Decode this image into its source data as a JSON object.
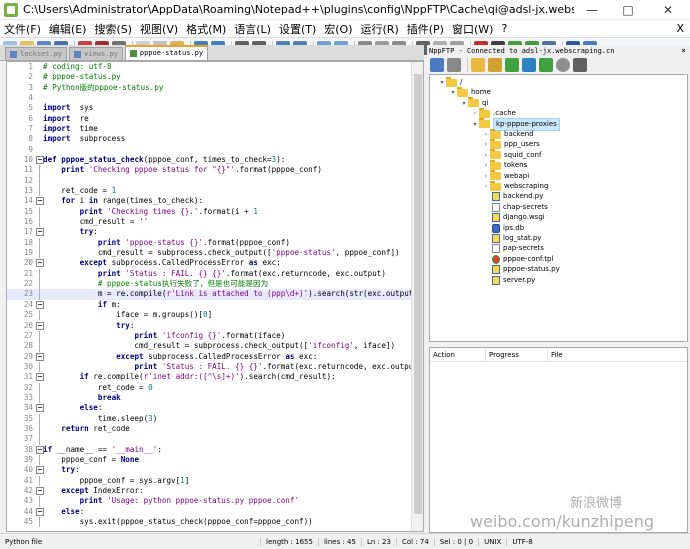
{
  "window": {
    "title": "C:\\Users\\Administrator\\AppData\\Roaming\\Notepad++\\plugins\\config\\NppFTP\\Cache\\qi@adsl-jx.webscraping.cn\\home\\qi\\kp-pppoe-proxies\\pppoe-status.py - Notepad++ [..."
  },
  "menu": {
    "items": [
      "文件(F)",
      "编辑(E)",
      "搜索(S)",
      "视图(V)",
      "格式(M)",
      "语言(L)",
      "设置(T)",
      "宏(O)",
      "运行(R)",
      "插件(P)",
      "窗口(W)",
      "?"
    ],
    "close_x": "X"
  },
  "tabs": [
    {
      "label": "lockset.py",
      "active": false
    },
    {
      "label": "views.py",
      "active": false
    },
    {
      "label": "pppoe-status.py",
      "active": true
    }
  ],
  "editor": {
    "lines": [
      [
        [
          "cm",
          "# coding: utf-8"
        ]
      ],
      [
        [
          "cm",
          "# pppoe-status.py"
        ]
      ],
      [
        [
          "cm",
          "# Python版的pppoe-status.py"
        ]
      ],
      [],
      [
        [
          "kw",
          "import"
        ],
        [
          "",
          "  sys"
        ]
      ],
      [
        [
          "kw",
          "import"
        ],
        [
          "",
          "  re"
        ]
      ],
      [
        [
          "kw",
          "import"
        ],
        [
          "",
          "  time"
        ]
      ],
      [
        [
          "kw",
          "import"
        ],
        [
          "",
          "  subprocess"
        ]
      ],
      [],
      [
        [
          "kw",
          "def"
        ],
        [
          "",
          " "
        ],
        [
          "fn",
          "pppoe_status_check"
        ],
        [
          "",
          "(pppoe_conf, times_to_check="
        ],
        [
          "nm",
          "3"
        ],
        [
          "",
          "):"
        ]
      ],
      [
        [
          "",
          "    "
        ],
        [
          "kw",
          "print"
        ],
        [
          "",
          ""
        ],
        [
          "st",
          " 'Checking pppoe status for \"{}\"'"
        ],
        [
          "",
          ".format(pppoe_conf)"
        ]
      ],
      [],
      [
        [
          "",
          "    ret_code = "
        ],
        [
          "nm",
          "1"
        ]
      ],
      [
        [
          "",
          "    "
        ],
        [
          "kw",
          "for"
        ],
        [
          "",
          " i "
        ],
        [
          "kw",
          "in"
        ],
        [
          "",
          " range(times_to_check):"
        ]
      ],
      [
        [
          "",
          "        "
        ],
        [
          "kw",
          "print"
        ],
        [
          "st",
          " 'Checking times {}.'"
        ],
        [
          "",
          ".format(i + "
        ],
        [
          "nm",
          "1"
        ],
        [
          ")"
        ]
      ],
      [
        [
          "",
          "        cmd_result = "
        ],
        [
          "st",
          "''"
        ]
      ],
      [
        [
          "",
          "        "
        ],
        [
          "kw",
          "try"
        ],
        [
          "",
          ":"
        ]
      ],
      [
        [
          "",
          "            "
        ],
        [
          "kw",
          "print"
        ],
        [
          "st",
          " 'pppoe-status {}'"
        ],
        [
          "",
          ".format(pppoe_conf)"
        ]
      ],
      [
        [
          "",
          "            cmd_result = subprocess.check_output(["
        ],
        [
          "st",
          "'pppoe-status'"
        ],
        [
          "",
          ", pppoe_conf])"
        ]
      ],
      [
        [
          "",
          "        "
        ],
        [
          "kw",
          "except"
        ],
        [
          "",
          " subprocess.CalledProcessError "
        ],
        [
          "kw",
          "as"
        ],
        [
          "",
          " exc:"
        ]
      ],
      [
        [
          "",
          "            "
        ],
        [
          "kw",
          "print"
        ],
        [
          "st",
          " 'Status : FAIL. {} {}'"
        ],
        [
          "",
          ".format(exc.returncode, exc.output)"
        ]
      ],
      [
        [
          "",
          "            "
        ],
        [
          "cm",
          "# pppoe-status执行失败了，但是也可能是因为"
        ]
      ],
      [
        [
          "",
          "            m = re.compile("
        ],
        [
          "st",
          "r'Link is attached to (ppp\\d+)'"
        ],
        [
          "",
          ").search(str(exc.output))"
        ]
      ],
      [
        [
          "",
          "            "
        ],
        [
          "kw",
          "if"
        ],
        [
          "",
          " m:"
        ]
      ],
      [
        [
          "",
          "                iface = m.groups()["
        ],
        [
          "nm",
          "0"
        ],
        [
          "",
          "]"
        ]
      ],
      [
        [
          "",
          "                "
        ],
        [
          "kw",
          "try"
        ],
        [
          "",
          ":"
        ]
      ],
      [
        [
          "",
          "                    "
        ],
        [
          "kw",
          "print"
        ],
        [
          "st",
          " 'ifconfig {}'"
        ],
        [
          "",
          ".format(iface)"
        ]
      ],
      [
        [
          "",
          "                    cmd_result = subprocess.check_output(["
        ],
        [
          "st",
          "'ifconfig'"
        ],
        [
          "",
          ", iface])"
        ]
      ],
      [
        [
          "",
          "                "
        ],
        [
          "kw",
          "except"
        ],
        [
          "",
          " subprocess.CalledProcessError "
        ],
        [
          "kw",
          "as"
        ],
        [
          "",
          " exc:"
        ]
      ],
      [
        [
          "",
          "                    "
        ],
        [
          "kw",
          "print"
        ],
        [
          "st",
          " 'Status : FAIL. {} {}'"
        ],
        [
          "",
          ".format(exc.returncode, exc.output)"
        ]
      ],
      [
        [
          "",
          "        "
        ],
        [
          "kw",
          "if"
        ],
        [
          "",
          " re.compile("
        ],
        [
          "st",
          "r'inet addr:([^\\s]+)'"
        ],
        [
          "",
          ").search(cmd_result):"
        ]
      ],
      [
        [
          "",
          "            ret_code = "
        ],
        [
          "nm",
          "0"
        ]
      ],
      [
        [
          "",
          "            "
        ],
        [
          "kw",
          "break"
        ]
      ],
      [
        [
          "",
          "        "
        ],
        [
          "kw",
          "else"
        ],
        [
          "",
          ":"
        ]
      ],
      [
        [
          "",
          "            time.sleep("
        ],
        [
          "nm",
          "3"
        ],
        [
          "",
          ")"
        ]
      ],
      [
        [
          "",
          "    "
        ],
        [
          "kw",
          "return"
        ],
        [
          "",
          " ret_code"
        ]
      ],
      [],
      [
        [
          "kw",
          "if"
        ],
        [
          "",
          " __name__ == "
        ],
        [
          "st",
          "'__main__'"
        ],
        [
          "",
          ":"
        ]
      ],
      [
        [
          "",
          "    pppoe_conf = "
        ],
        [
          "kw",
          "None"
        ]
      ],
      [
        [
          "",
          "    "
        ],
        [
          "kw",
          "try"
        ],
        [
          "",
          ":"
        ]
      ],
      [
        [
          "",
          "        pppoe_conf = sys.argv["
        ],
        [
          "nm",
          "1"
        ],
        [
          "",
          "]"
        ]
      ],
      [
        [
          "",
          "    "
        ],
        [
          "kw",
          "except"
        ],
        [
          "",
          " IndexError:"
        ]
      ],
      [
        [
          "",
          "        "
        ],
        [
          "kw",
          "print"
        ],
        [
          "st",
          " 'Usage: python pppoe-status.py pppoe.conf'"
        ]
      ],
      [
        [
          "",
          "    "
        ],
        [
          "kw",
          "else"
        ],
        [
          "",
          ":"
        ]
      ],
      [
        [
          "",
          "        sys.exit(pppoe_status_check(pppoe_conf=pppoe_conf))"
        ]
      ]
    ],
    "current_line": 23
  },
  "status": {
    "language": "Python file",
    "length": "length : 1655",
    "lines": "lines : 45",
    "ln": "Ln : 23",
    "col": "Col : 74",
    "sel": "Sel : 0 | 0",
    "eol": "UNIX",
    "encoding": "UTF-8"
  },
  "ftp": {
    "title": "NppFTP - Connected to adsl-jx.webscraping.cn",
    "close": "×",
    "tree": [
      {
        "label": "/",
        "type": "folder",
        "level": 0,
        "arrow": "▾"
      },
      {
        "label": "home",
        "type": "folder",
        "level": 1,
        "arrow": "▾"
      },
      {
        "label": "qi",
        "type": "folder",
        "level": 2,
        "arrow": "▾"
      },
      {
        "label": ".cache",
        "type": "folder",
        "level": 3,
        "arrow": "›"
      },
      {
        "label": "kp-pppoe-proxies",
        "type": "folder",
        "level": 3,
        "arrow": "▾",
        "selected": true
      },
      {
        "label": "backend",
        "type": "folder",
        "level": 4,
        "arrow": "›"
      },
      {
        "label": "ppp_users",
        "type": "folder",
        "level": 4,
        "arrow": "›"
      },
      {
        "label": "squid_conf",
        "type": "folder",
        "level": 4,
        "arrow": "›"
      },
      {
        "label": "tokens",
        "type": "folder",
        "level": 4,
        "arrow": "›"
      },
      {
        "label": "webapi",
        "type": "folder",
        "level": 4,
        "arrow": "›"
      },
      {
        "label": "webscraping",
        "type": "folder",
        "level": 4,
        "arrow": "›"
      },
      {
        "label": "backend.py",
        "type": "py",
        "level": 4,
        "arrow": ""
      },
      {
        "label": "chap-secrets",
        "type": "file",
        "level": 4,
        "arrow": ""
      },
      {
        "label": "django.wsgi",
        "type": "py",
        "level": 4,
        "arrow": ""
      },
      {
        "label": "ips.db",
        "type": "db",
        "level": 4,
        "arrow": ""
      },
      {
        "label": "log_stat.py",
        "type": "py",
        "level": 4,
        "arrow": ""
      },
      {
        "label": "pap-secrets",
        "type": "file",
        "level": 4,
        "arrow": ""
      },
      {
        "label": "pppoe-conf.tpl",
        "type": "chrome",
        "level": 4,
        "arrow": ""
      },
      {
        "label": "pppoe-status.py",
        "type": "py",
        "level": 4,
        "arrow": ""
      },
      {
        "label": "server.py",
        "type": "py",
        "level": 4,
        "arrow": ""
      }
    ],
    "queue_headers": [
      "Action",
      "Progress",
      "File"
    ]
  },
  "watermark": {
    "line1": "新浪微博",
    "line2": "weibo.com/kunzhipeng"
  }
}
